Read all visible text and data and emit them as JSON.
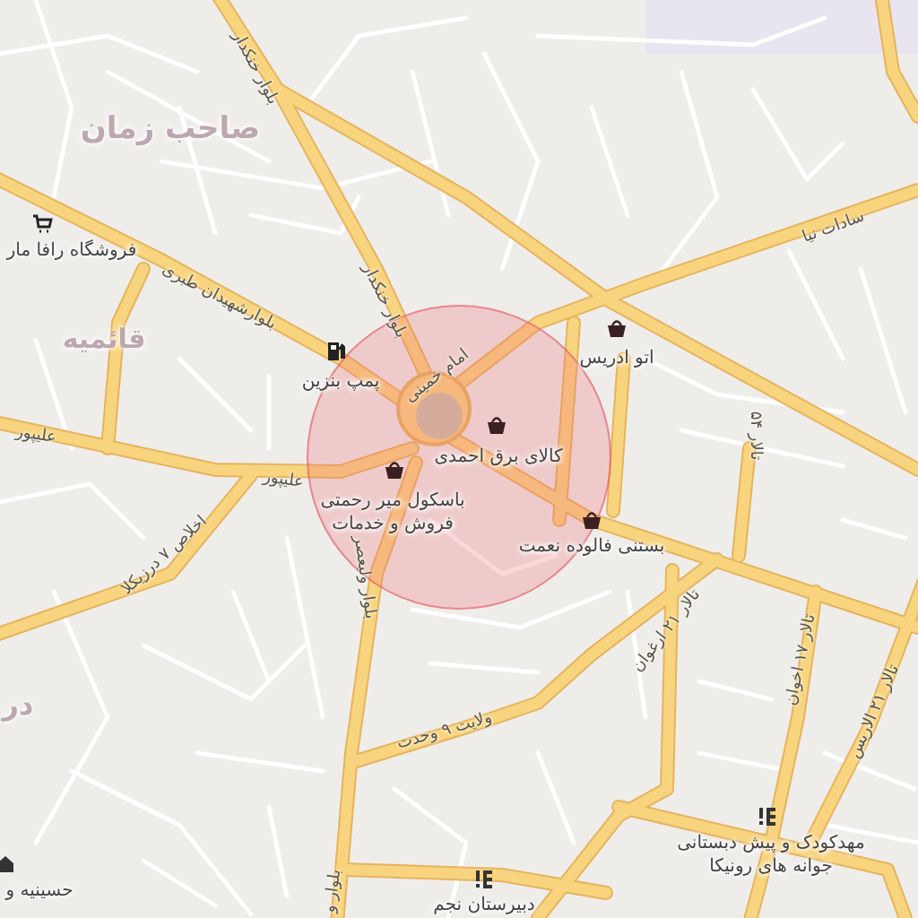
{
  "map": {
    "districts": [
      {
        "name": "صاحب زمان"
      },
      {
        "name": "قائمیه"
      },
      {
        "name": "در"
      }
    ],
    "streets": [
      {
        "name": "بلوار خنکدار"
      },
      {
        "name": "بلوار خنکدار"
      },
      {
        "name": "بلوارشهیدان طبری"
      },
      {
        "name": "علیپور"
      },
      {
        "name": "علیپور"
      },
      {
        "name": "سادات نیا"
      },
      {
        "name": "امام خمینی"
      },
      {
        "name": "اخلاص ۷ درزیکلا"
      },
      {
        "name": "بلوار ولیعصر"
      },
      {
        "name": "بلوار و"
      },
      {
        "name": "ولایت ۹ وحدت"
      },
      {
        "name": "تالار ۲۱ ارغوان"
      },
      {
        "name": "تالار ۱۷ اخوان"
      },
      {
        "name": "تالار ۲۱ الاریس"
      },
      {
        "name": "تالار ۵۴"
      }
    ],
    "places": [
      {
        "kind": "cart",
        "lines": [
          "فروشگاه رافا مار"
        ]
      },
      {
        "kind": "fuel",
        "lines": [
          "پمپ بنزین"
        ]
      },
      {
        "kind": "shop",
        "lines": [
          "اتو ادریس"
        ]
      },
      {
        "kind": "shop",
        "lines": [
          "کالای برق احمدی"
        ]
      },
      {
        "kind": "shop",
        "lines": [
          "باسکول میر رحمتی",
          "فروش و خدمات"
        ]
      },
      {
        "kind": "shop",
        "lines": [
          "بستنی فالوده نعمت"
        ]
      },
      {
        "kind": "school",
        "lines": [
          "مهدکودک و پیش دبستانی",
          "جوانه های رونیکا"
        ]
      },
      {
        "kind": "school",
        "lines": [
          "دبیرستان نجم"
        ]
      },
      {
        "kind": "worship",
        "lines": [
          "حسینیه و"
        ]
      }
    ]
  }
}
